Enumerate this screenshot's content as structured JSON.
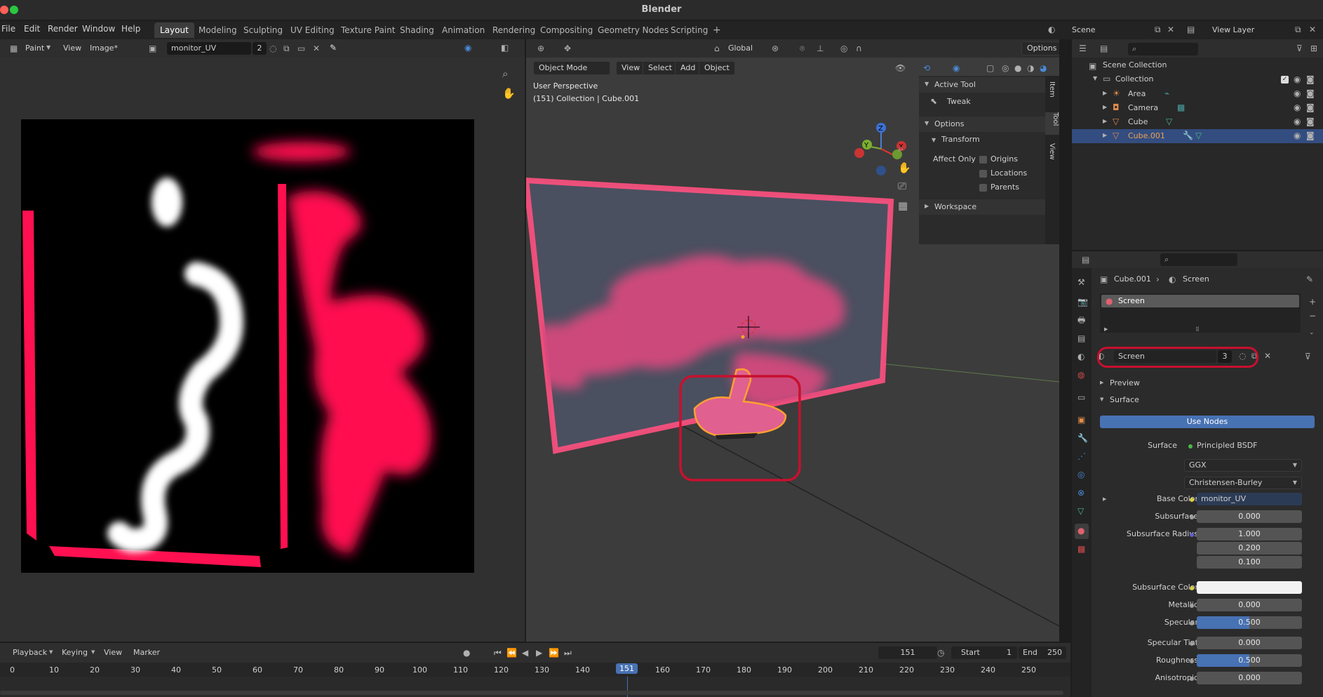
{
  "app": {
    "title": "Blender"
  },
  "menus": [
    "File",
    "Edit",
    "Render",
    "Window",
    "Help"
  ],
  "workspaces": [
    {
      "label": "Layout",
      "active": true
    },
    {
      "label": "Modeling"
    },
    {
      "label": "Sculpting"
    },
    {
      "label": "UV Editing"
    },
    {
      "label": "Texture Paint"
    },
    {
      "label": "Shading"
    },
    {
      "label": "Animation"
    },
    {
      "label": "Rendering"
    },
    {
      "label": "Compositing"
    },
    {
      "label": "Geometry Nodes"
    },
    {
      "label": "Scripting"
    }
  ],
  "scene": {
    "name": "Scene",
    "view_layer": "View Layer"
  },
  "image_editor": {
    "mode": "Paint",
    "view_menu": "View",
    "image_menu": "Image*",
    "image_name": "monitor_UV",
    "users": "2"
  },
  "viewport": {
    "transform": "Global",
    "options": "Options",
    "mode": "Object Mode",
    "menus": [
      "View",
      "Select",
      "Add",
      "Object"
    ],
    "perspective": "User Perspective",
    "collection_info": "(151) Collection | Cube.001"
  },
  "npanel": {
    "active_tool_header": "Active Tool",
    "tool": "Tweak",
    "options_header": "Options",
    "transform_header": "Transform",
    "affect_only": "Affect Only",
    "checkboxes": [
      "Origins",
      "Locations",
      "Parents"
    ],
    "workspace_header": "Workspace",
    "tabs": [
      "Item",
      "Tool",
      "View"
    ]
  },
  "outliner": {
    "root": "Scene Collection",
    "collection": "Collection",
    "items": [
      "Area",
      "Camera",
      "Cube",
      "Cube.001"
    ],
    "selected": "Cube.001"
  },
  "properties": {
    "breadcrumb_object": "Cube.001",
    "breadcrumb_material": "Screen",
    "slot_name": "Screen",
    "material_name": "Screen",
    "material_users": "3",
    "preview_header": "Preview",
    "surface_header": "Surface",
    "use_nodes": "Use Nodes",
    "surface_label": "Surface",
    "surface_value": "Principled BSDF",
    "distribution": "GGX",
    "subsurface_method": "Christensen-Burley",
    "rows": [
      {
        "label": "Base Color",
        "value": "monitor_UV",
        "kind": "link"
      },
      {
        "label": "Subsurface",
        "value": "0.000",
        "fill": 0
      },
      {
        "label": "Subsurface Radius",
        "value": "1.000",
        "fill": 0
      },
      {
        "label": "",
        "value": "0.200",
        "fill": 0
      },
      {
        "label": "",
        "value": "0.100",
        "fill": 0
      },
      {
        "label": "Subsurface Color",
        "value": "",
        "kind": "color"
      },
      {
        "label": "Metallic",
        "value": "0.000",
        "fill": 0
      },
      {
        "label": "Specular",
        "value": "0.500",
        "fill": 0.5
      },
      {
        "label": "Specular Tint",
        "value": "0.000",
        "fill": 0
      },
      {
        "label": "Roughness",
        "value": "0.500",
        "fill": 0.5
      },
      {
        "label": "Anisotropic",
        "value": "0.000",
        "fill": 0
      }
    ]
  },
  "timeline": {
    "menus": [
      "Playback",
      "Keying",
      "View",
      "Marker"
    ],
    "current_frame": "151",
    "start_label": "Start",
    "start": "1",
    "end_label": "End",
    "end": "250",
    "ticks": [
      "0",
      "10",
      "20",
      "30",
      "40",
      "50",
      "60",
      "70",
      "80",
      "90",
      "100",
      "110",
      "120",
      "130",
      "140",
      "151",
      "160",
      "170",
      "180",
      "190",
      "200",
      "210",
      "220",
      "230",
      "240",
      "250"
    ]
  },
  "colors": {
    "accent": "#4772b3",
    "highlight": "#c8102e",
    "paint": "#ff1050",
    "selected_row": "#334d80"
  }
}
